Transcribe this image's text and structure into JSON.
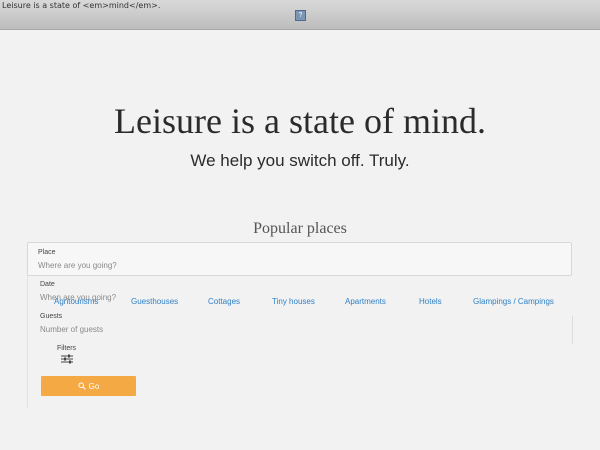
{
  "topbar": {
    "title_text": "Leisure is a state of <em>mind</em>.",
    "broken_image_glyph": "?"
  },
  "hero": {
    "title": "Leisure is a state of mind.",
    "subtitle": "We help you switch off. Truly."
  },
  "popular": {
    "title": "Popular places",
    "categories": [
      "Agritourisms",
      "Guesthouses",
      "Cottages",
      "Tiny houses",
      "Apartments",
      "Hotels",
      "Glampings / Campings"
    ]
  },
  "search": {
    "place_label": "Place",
    "place_placeholder": "Where are you going?",
    "date_label": "Date",
    "date_placeholder": "When are you going?",
    "guests_label": "Guests",
    "guests_placeholder": "Number of guests",
    "filters_label": "Filters",
    "filters_icon": "sliders-icon",
    "go_label": "Go",
    "go_icon": "search-icon"
  },
  "colors": {
    "background": "#f2f2f2",
    "accent_button": "#f5a945",
    "link": "#2f80c7"
  }
}
